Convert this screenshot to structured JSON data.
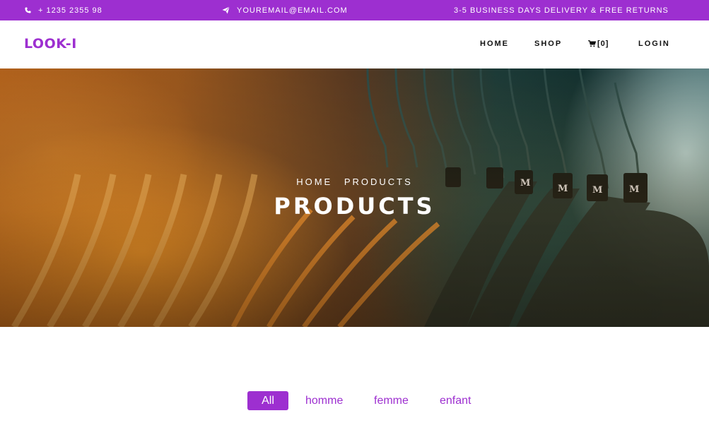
{
  "topbar": {
    "phone": "+ 1235 2355 98",
    "email": "YOUREMAIL@EMAIL.COM",
    "delivery": "3-5 BUSINESS DAYS DELIVERY & FREE RETURNS",
    "phone_icon": "phone-icon",
    "email_icon": "paper-plane-icon"
  },
  "brand": {
    "logo": "LOOK-I",
    "accent_color": "#9d2fd0"
  },
  "nav": {
    "home": "HOME",
    "shop": "SHOP",
    "cart": "[0]",
    "cart_icon": "cart-icon",
    "login": "LOGIN"
  },
  "hero": {
    "breadcrumb": [
      "HOME",
      "PRODUCTS"
    ],
    "title": "PRODUCTS",
    "hanger_tag": "M"
  },
  "filters": {
    "items": [
      "All",
      "homme",
      "femme",
      "enfant"
    ],
    "active": "All"
  }
}
